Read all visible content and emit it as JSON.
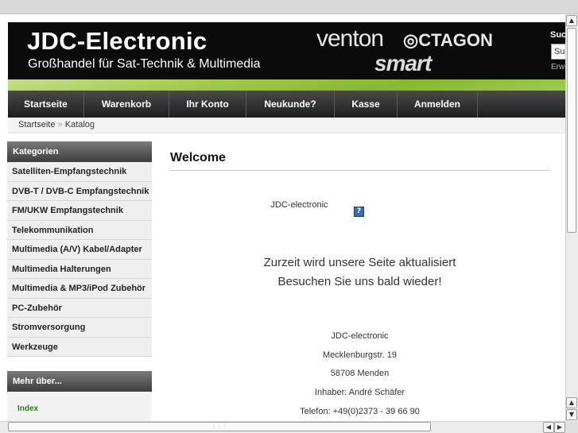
{
  "header": {
    "brand_title": "JDC-Electronic",
    "brand_subtitle": "Großhandel für Sat-Technik & Multimedia",
    "partner_logos": [
      "venton",
      "CTAGON",
      "smart"
    ],
    "search": {
      "label": "Suc",
      "value": "Suc",
      "advanced": "Erwe"
    }
  },
  "nav": {
    "items": [
      {
        "label": "Startseite"
      },
      {
        "label": "Warenkorb"
      },
      {
        "label": "Ihr Konto"
      },
      {
        "label": "Neukunde?"
      },
      {
        "label": "Kasse"
      },
      {
        "label": "Anmelden"
      }
    ]
  },
  "breadcrumb": {
    "home": "Startseite",
    "separator": "»",
    "current": "Katalog"
  },
  "sidebar": {
    "categories_title": "Kategorien",
    "categories": [
      "Satelliten-Empfangstechnik",
      "DVB-T / DVB-C Empfangstechnik",
      "FM/UKW Empfangstechnik",
      "Telekommunikation",
      "Multimedia (A/V) Kabel/Adapter",
      "Multimedia Halterungen",
      "Multimedia & MP3/iPod Zubehör",
      "PC-Zubehör",
      "Stromversorgung",
      "Werkzeuge"
    ],
    "more_title": "Mehr über...",
    "more_link": "Index"
  },
  "main": {
    "heading": "Welcome",
    "company_name": "JDC-electronic",
    "notice_line1": "Zurzeit wird unsere Seite aktualisiert",
    "notice_line2": "Besuchen Sie uns bald wieder!",
    "address": {
      "name": "JDC-electronic",
      "street": "Mecklenburgstr. 19",
      "city": "58708 Menden",
      "owner": "Inhaber: André Schäfer",
      "phone": "Telefon: +49(0)2373 - 39 66 90"
    }
  },
  "colors": {
    "nav_bg": "#2a2a2a",
    "accent_green": "#8dbd38",
    "banner_bg": "#0b0b0b"
  }
}
